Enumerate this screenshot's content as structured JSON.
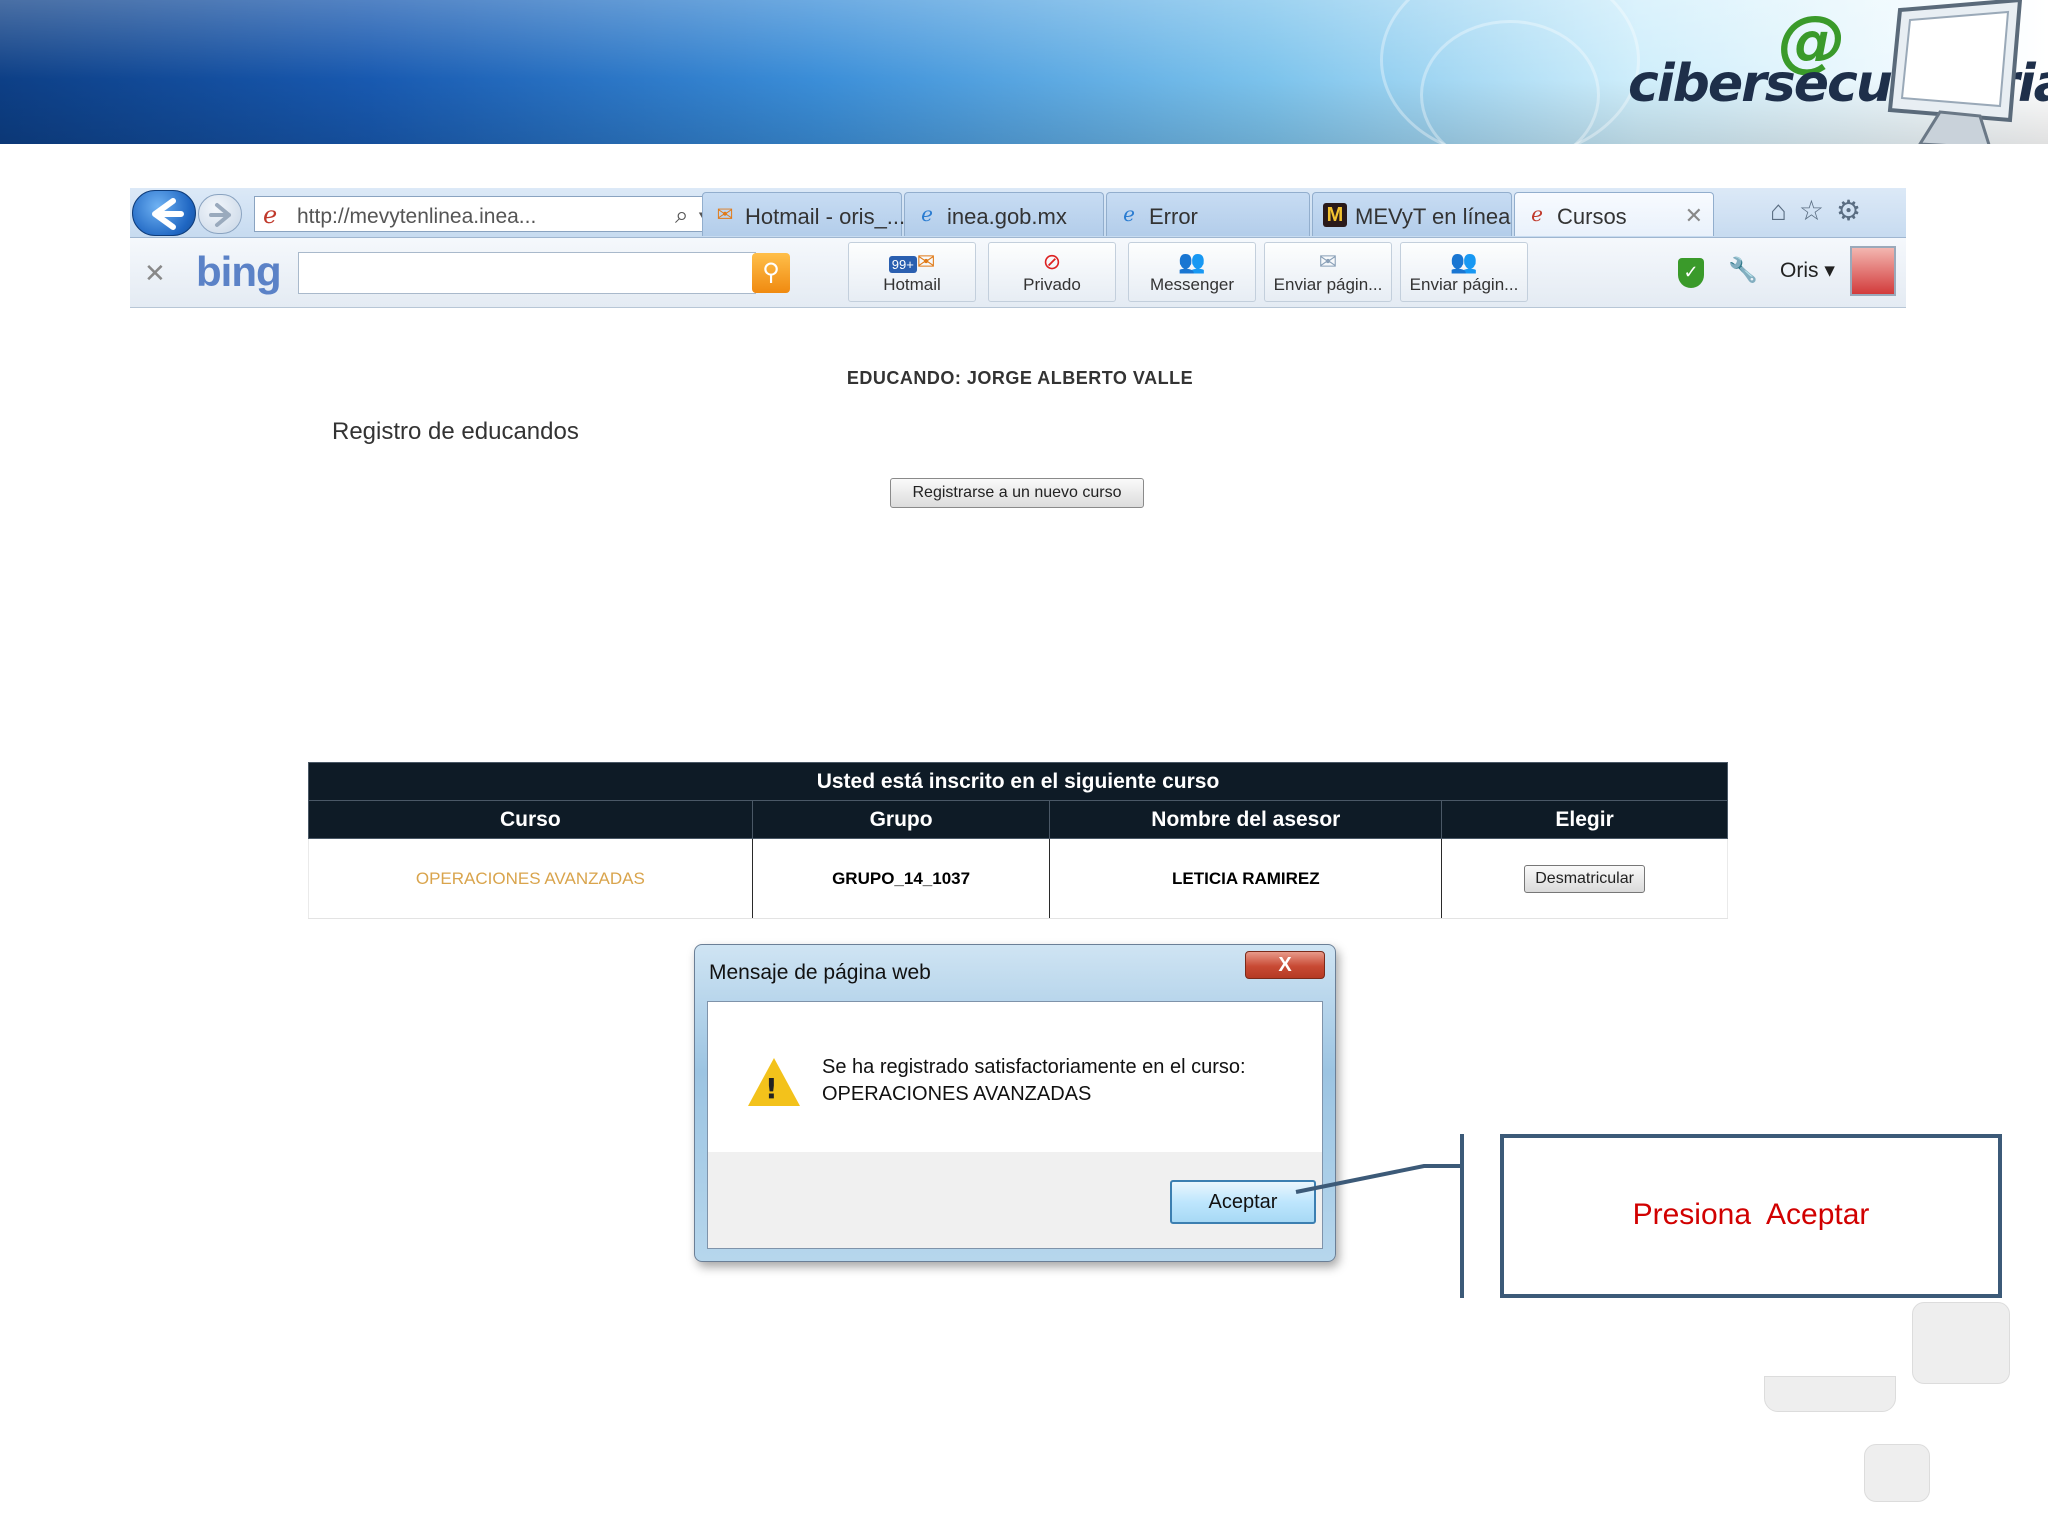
{
  "banner": {
    "logo_at": "@",
    "logo_text": "cibersecundaria"
  },
  "browser": {
    "address": "http://mevytenlinea.inea...",
    "address_icons": "⌕▾ ⎘↻✕",
    "tabs": [
      {
        "label": "Hotmail - oris_...",
        "icon": "mail-icon"
      },
      {
        "label": "inea.gob.mx",
        "icon": "ie-icon"
      },
      {
        "label": "Error",
        "icon": "ie-icon"
      },
      {
        "label": "MEVyT en línea",
        "icon": "mevyt-icon"
      },
      {
        "label": "Cursos",
        "icon": "ie-icon"
      }
    ],
    "right_icons": [
      "home-icon",
      "star-icon",
      "gear-icon"
    ],
    "toolbar": {
      "bing": "bing",
      "search_value": "",
      "buttons": [
        {
          "label": "Hotmail",
          "badge": "99+"
        },
        {
          "label": "Privado"
        },
        {
          "label": "Messenger"
        },
        {
          "label": "Enviar págin..."
        },
        {
          "label": "Enviar págin..."
        }
      ],
      "user": "Oris ▾"
    }
  },
  "page": {
    "educando": "EDUCANDO: JORGE ALBERTO VALLE",
    "title": "Registro de educandos",
    "new_course_button": "Registrarse a un nuevo curso",
    "table": {
      "caption": "Usted está inscrito en el siguiente curso",
      "headers": [
        "Curso",
        "Grupo",
        "Nombre del asesor",
        "Elegir"
      ],
      "row": {
        "curso": "OPERACIONES AVANZADAS",
        "grupo": "GRUPO_14_1037",
        "asesor": "LETICIA RAMIREZ",
        "action": "Desmatricular"
      }
    }
  },
  "dialog": {
    "title": "Mensaje de página web",
    "close": "X",
    "message_line1": "Se ha registrado satisfactoriamente en el curso:",
    "message_line2": "OPERACIONES AVANZADAS",
    "ok": "Aceptar"
  },
  "callout": {
    "text": "Presiona  Aceptar",
    "color": "#d10000"
  }
}
